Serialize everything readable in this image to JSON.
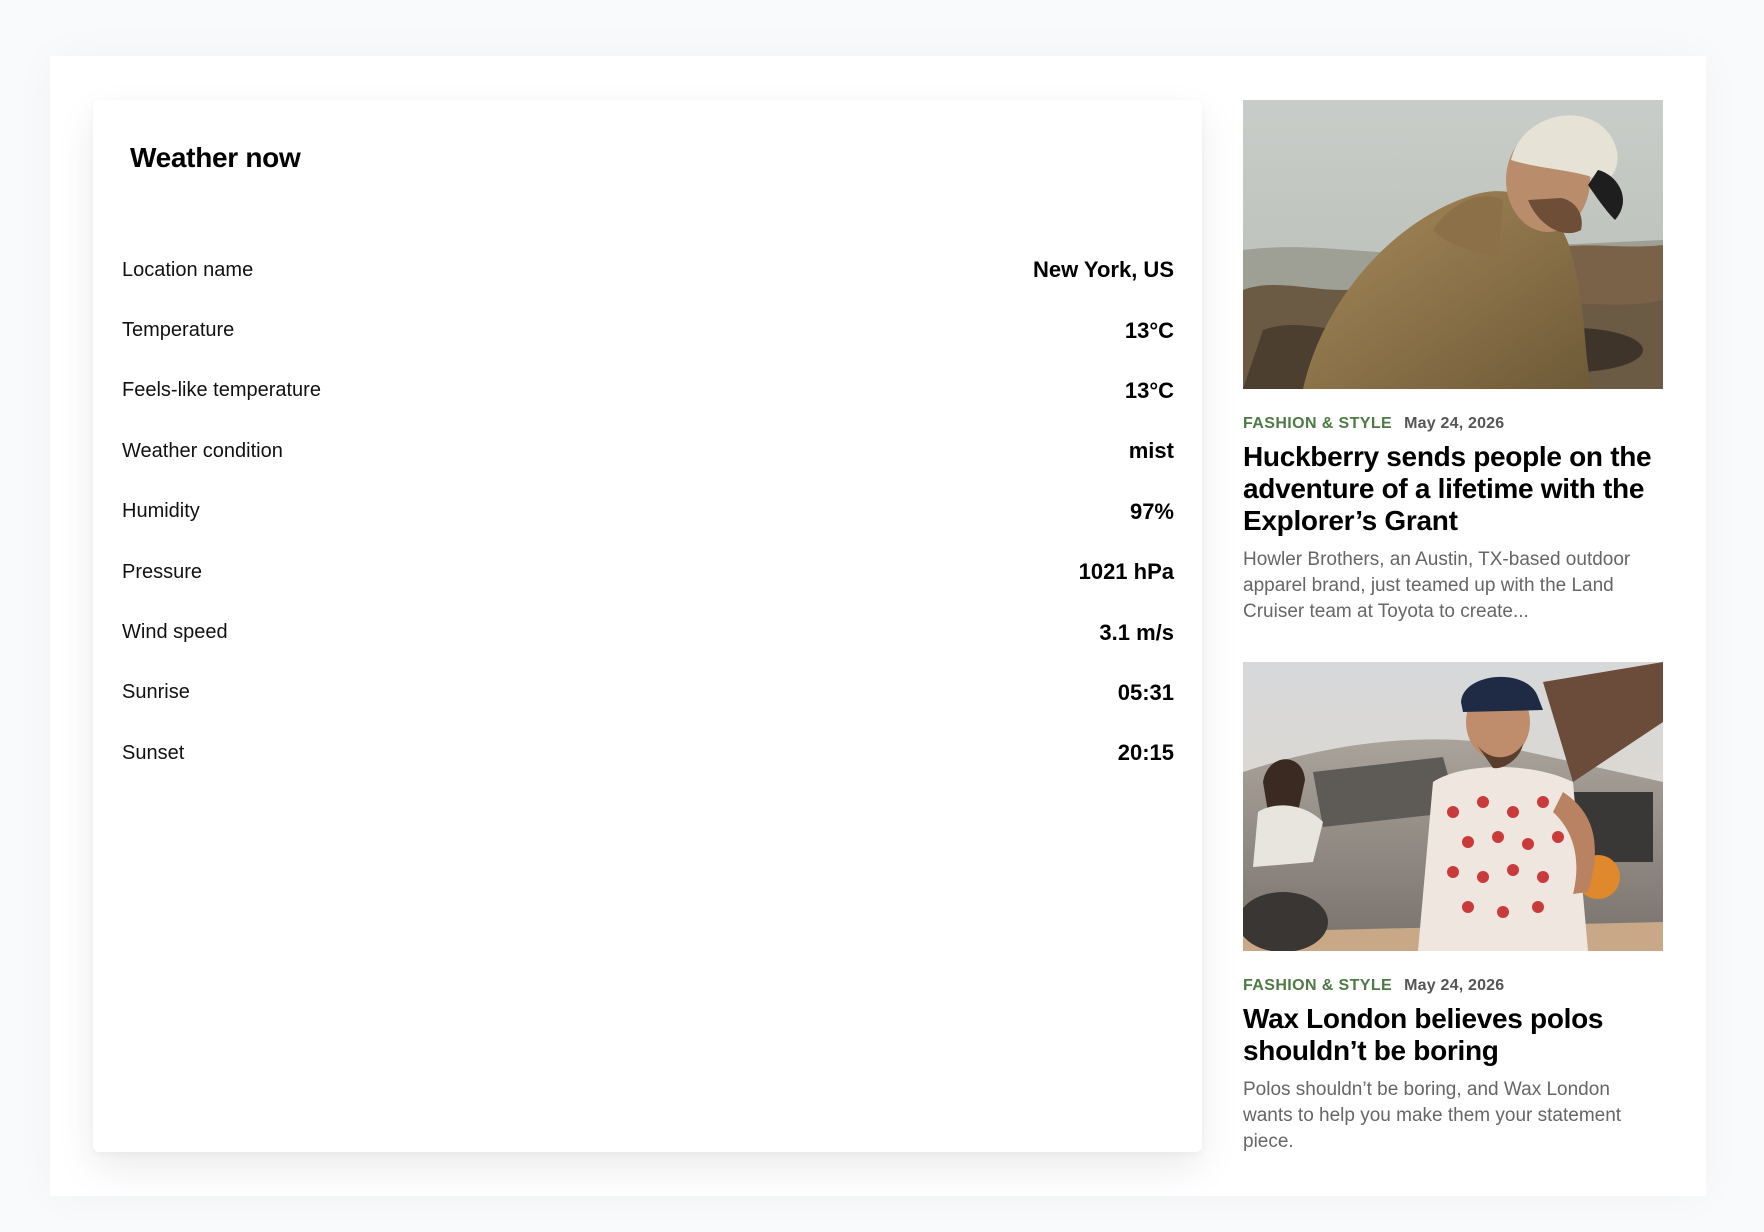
{
  "weather": {
    "title": "Weather now",
    "rows": [
      {
        "label": "Location name",
        "value": "New York, US"
      },
      {
        "label": "Temperature",
        "value": "13°C"
      },
      {
        "label": "Feels-like temperature",
        "value": "13°C"
      },
      {
        "label": "Weather condition",
        "value": "mist"
      },
      {
        "label": "Humidity",
        "value": "97%"
      },
      {
        "label": "Pressure",
        "value": "1021 hPa"
      },
      {
        "label": "Wind speed",
        "value": "3.1 m/s"
      },
      {
        "label": "Sunrise",
        "value": "05:31"
      },
      {
        "label": "Sunset",
        "value": "20:15"
      }
    ]
  },
  "articles": [
    {
      "category": "FASHION & STYLE",
      "date": "May 24, 2026",
      "title": "Huckberry sends people on the adventure of a lifetime with the Explorer’s Grant",
      "excerpt": "Howler Brothers, an Austin, TX-based outdoor apparel brand, just teamed up with the Land Cruiser team at Toyota to create...",
      "image": "photo-man-in-jacket-by-sea"
    },
    {
      "category": "FASHION & STYLE",
      "date": "May 24, 2026",
      "title": "Wax London believes polos shouldn’t be boring",
      "excerpt": "Polos shouldn’t be boring, and Wax London wants to help you make them your statement piece.",
      "image": "photo-man-by-truck"
    }
  ],
  "colors": {
    "category": "#4d7a45",
    "page_background": "#f9fafb"
  }
}
